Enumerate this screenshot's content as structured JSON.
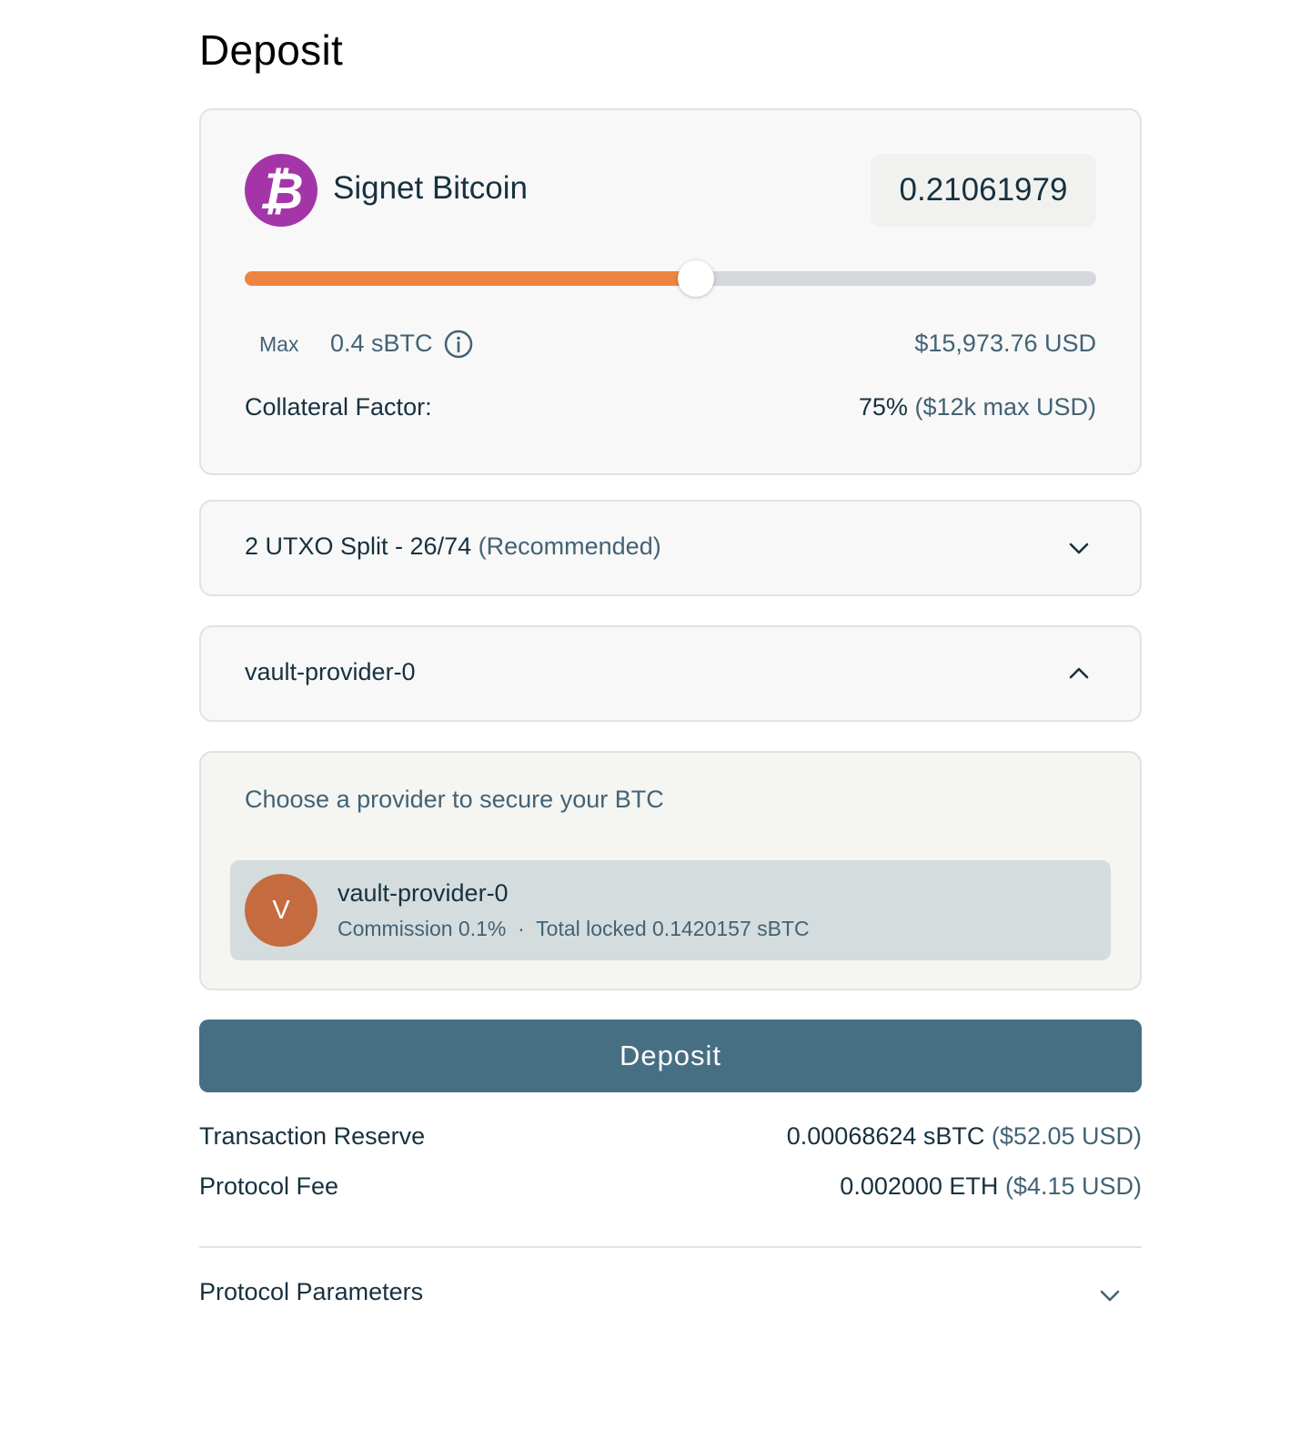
{
  "page": {
    "title": "Deposit"
  },
  "asset": {
    "icon": "bitcoin-icon",
    "icon_glyph": "₿",
    "icon_color": "#a435a8",
    "name": "Signet Bitcoin",
    "amount": "0.21061979"
  },
  "slider": {
    "value_fraction": 0.53,
    "fill_color": "#ee8441"
  },
  "max": {
    "label": "Max",
    "value": "0.4 sBTC",
    "info_icon": "info-icon"
  },
  "usd_value": "$15,973.76 USD",
  "collateral": {
    "label": "Collateral Factor:",
    "percent": "75%",
    "max_usd": "($12k max USD)"
  },
  "utxo": {
    "label": "2 UTXO Split - 26/74",
    "note": "(Recommended)",
    "icon": "chevron-down-icon"
  },
  "provider_select": {
    "label": "vault-provider-0",
    "icon": "chevron-up-icon"
  },
  "provider_list": {
    "title": "Choose a provider to secure your BTC",
    "items": [
      {
        "avatar_letter": "V",
        "avatar_color": "#c46b3f",
        "name": "vault-provider-0",
        "commission": "Commission 0.1%",
        "separator": "·",
        "total_locked": "Total locked 0.1420157 sBTC"
      }
    ]
  },
  "deposit_button": {
    "label": "Deposit",
    "color": "#476f84"
  },
  "fees": {
    "reserve": {
      "label": "Transaction Reserve",
      "value": "0.00068624 sBTC",
      "usd": "($52.05 USD)"
    },
    "protocol": {
      "label": "Protocol Fee",
      "value": "0.002000 ETH",
      "usd": "($4.15 USD)"
    }
  },
  "params": {
    "label": "Protocol Parameters",
    "icon": "chevron-down-icon"
  }
}
